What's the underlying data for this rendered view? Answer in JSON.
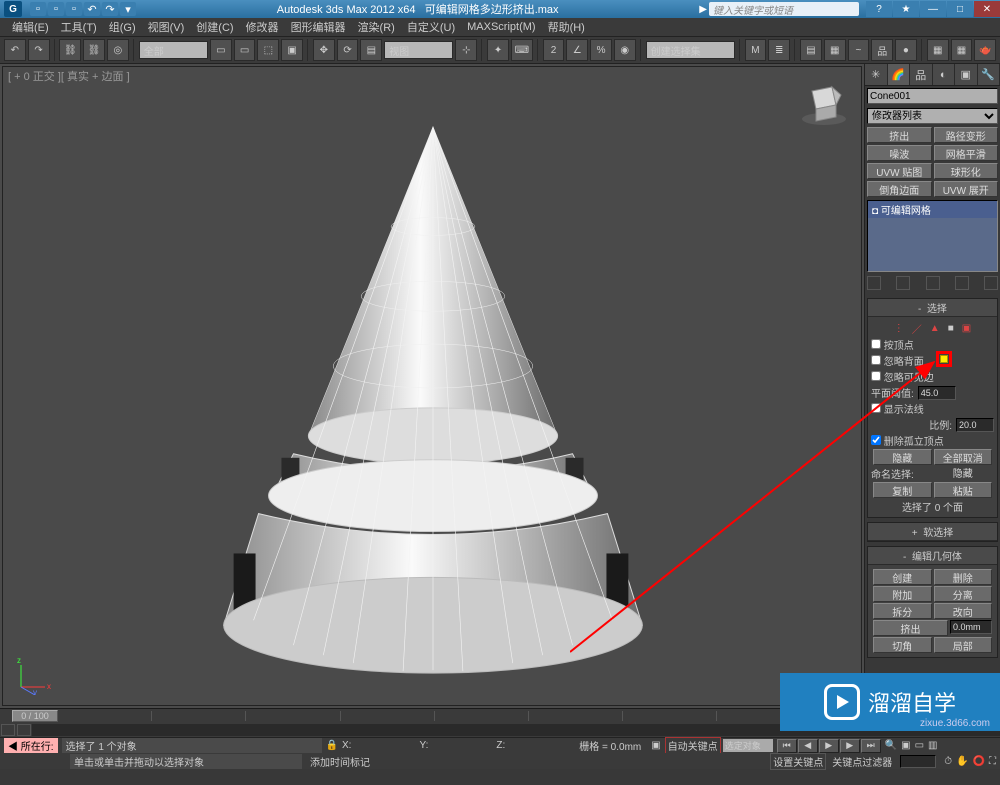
{
  "titlebar": {
    "app": "Autodesk 3ds Max 2012 x64",
    "doc": "可编辑网格多边形挤出.max",
    "search_placeholder": "键入关键字或短语"
  },
  "menu": [
    "编辑(E)",
    "工具(T)",
    "组(G)",
    "视图(V)",
    "创建(C)",
    "修改器",
    "图形编辑器",
    "渲染(R)",
    "自定义(U)",
    "MAXScript(M)",
    "帮助(H)"
  ],
  "toolbar": {
    "filter_all": "全部",
    "view_label": "视图",
    "named_sel": "创建选择集"
  },
  "viewport": {
    "label": "[ + 0 正交 ][ 真实 + 边面 ]"
  },
  "cmdpanel": {
    "object_name": "Cone001",
    "mod_list": "修改器列表",
    "presets": [
      [
        "挤出",
        "路径变形"
      ],
      [
        "噪波",
        "网格平滑"
      ],
      [
        "UVW 贴图",
        "球形化"
      ],
      [
        "倒角边面",
        "UVW 展开"
      ]
    ],
    "stack_item": "◘ 可编辑网格",
    "selection": {
      "header": "选择",
      "by_vertex": "按顶点",
      "ignore_back": "忽略背面",
      "ignore_vis": "忽略可见边",
      "plane_thresh": "平面阈值:",
      "plane_val": "45.0",
      "show_normals": "显示法线",
      "scale_lbl": "比例:",
      "scale_val": "20.0",
      "delete_iso": "删除孤立顶点",
      "hide": "隐藏",
      "unhide": "全部取消隐藏",
      "named_sel": "命名选择:",
      "copy": "复制",
      "paste": "粘贴",
      "count": "选择了 0 个面"
    },
    "softsel_header": "软选择",
    "editgeo": {
      "header": "编辑几何体",
      "create": "创建",
      "delete": "删除",
      "attach": "附加",
      "detach": "分离",
      "break": "拆分",
      "turn": "改向",
      "extrude": "挤出",
      "extrude_val": "0.0mm",
      "bevel": "切角",
      "outline": "局部"
    }
  },
  "status": {
    "frame": "0 / 100",
    "prompt1": "选择了 1 个对象",
    "prompt2": "单击或单击并拖动以选择对象",
    "x": "X:",
    "y": "Y:",
    "z": "Z:",
    "grid": "栅格 = 0.0mm",
    "autokey": "自动关键点",
    "selected": "选定对象",
    "setkey": "设置关键点",
    "keyfilter": "关键点过滤器",
    "addtime": "添加时间标记",
    "layer_now": "所在行:"
  },
  "watermark": {
    "text": "溜溜自学",
    "sub": "zixue.3d66.com"
  }
}
